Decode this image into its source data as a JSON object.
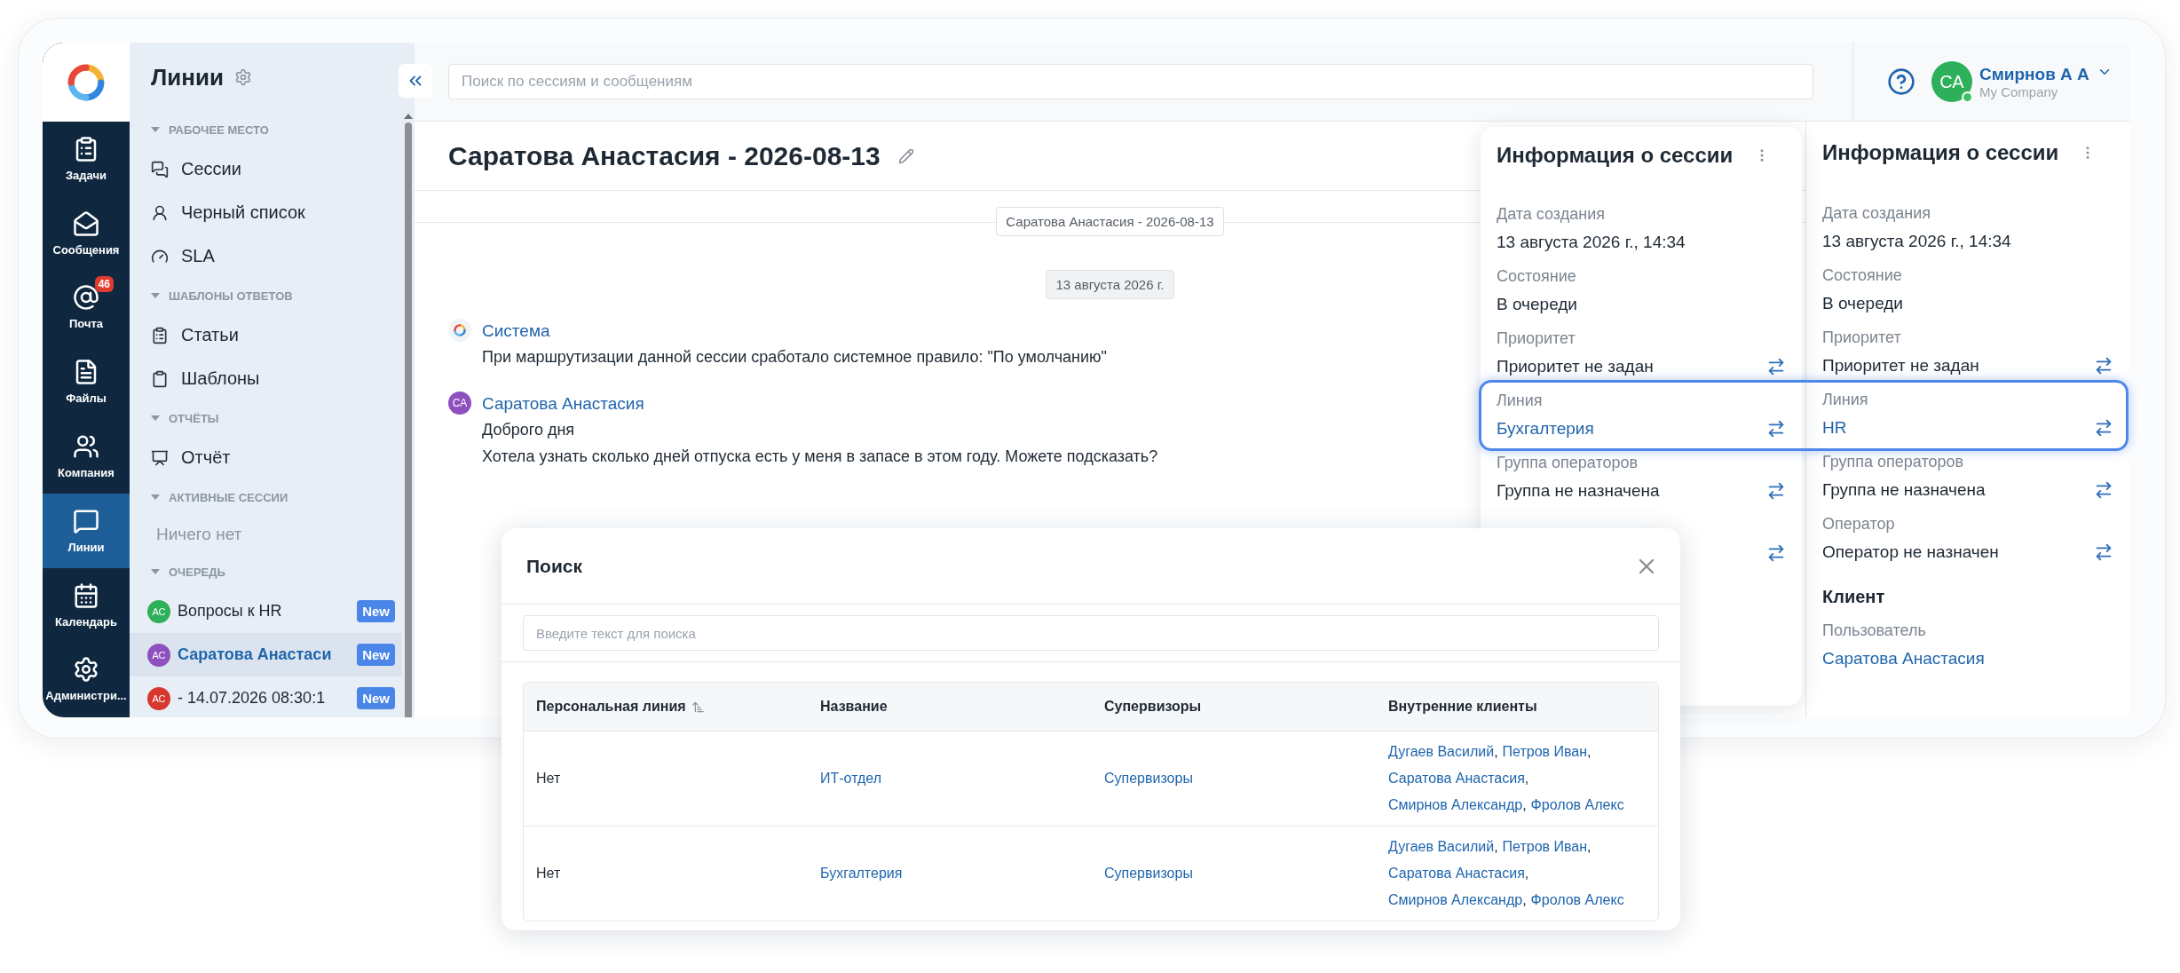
{
  "nav": {
    "items": [
      {
        "label": "Задачи",
        "selected": false
      },
      {
        "label": "Сообщения",
        "selected": false
      },
      {
        "label": "Почта",
        "badge": "46",
        "selected": false
      },
      {
        "label": "Файлы",
        "selected": false
      },
      {
        "label": "Компания",
        "selected": false
      },
      {
        "label": "Линии",
        "selected": true
      },
      {
        "label": "Календарь",
        "selected": false
      },
      {
        "label": "Администри...",
        "selected": false
      }
    ]
  },
  "sidebar": {
    "title": "Линии",
    "sections": [
      {
        "kind": "links",
        "title": "РАБОЧЕЕ МЕСТО",
        "items": [
          "Сессии",
          "Черный список",
          "SLA"
        ]
      },
      {
        "kind": "links",
        "title": "ШАБЛОНЫ ОТВЕТОВ",
        "items": [
          "Статьи",
          "Шаблоны"
        ]
      },
      {
        "kind": "links",
        "title": "ОТЧЁТЫ",
        "items": [
          "Отчёт"
        ]
      },
      {
        "kind": "empty",
        "title": "АКТИВНЫЕ СЕССИИ",
        "text": "Ничего нет"
      },
      {
        "kind": "queue",
        "title": "ОЧЕРЕДЬ",
        "items": [
          {
            "initials": "АС",
            "name": "Вопросы к HR",
            "badge": "New",
            "color": "#2eb05a",
            "selected": false
          },
          {
            "initials": "АС",
            "name": "Саратова Анастаси",
            "badge": "New",
            "color": "#8e4fbf",
            "selected": true
          },
          {
            "initials": "АС",
            "name": "- 14.07.2026 08:30:1",
            "badge": "New",
            "color": "#d7382e",
            "selected": false
          }
        ]
      }
    ]
  },
  "header": {
    "search_placeholder": "Поиск по сессиям и сообщениям",
    "user": {
      "initials": "СА",
      "name": "Смирнов А А",
      "company": "My Company",
      "online": true
    }
  },
  "chat": {
    "title": "Саратова Анастасия - 2026-08-13",
    "separator": "Саратова Анастасия - 2026-08-13",
    "date": "13 августа 2026 г.",
    "messages": [
      {
        "kind": "system",
        "author": "Система",
        "lines": [
          "При маршрутизации данной сессии сработало системное правило: \"По умолчанию\""
        ]
      },
      {
        "kind": "user",
        "initials": "СА",
        "author": "Саратова Анастасия",
        "lines": [
          "Доброго дня",
          "Хотела узнать сколько дней отпуска есть у меня в запасе в этом году. Можете подсказать?"
        ]
      }
    ]
  },
  "session_card": {
    "title": "Информация о сессии",
    "rows": [
      {
        "kind": "field",
        "label": "Дата создания",
        "value": "13 августа 2026 г., 14:34",
        "link": false,
        "swap": false
      },
      {
        "kind": "field",
        "label": "Состояние",
        "value": "В очереди",
        "link": false,
        "swap": false
      },
      {
        "kind": "field",
        "label": "Приоритет",
        "value": "Приоритет не задан",
        "link": false,
        "swap": true
      },
      {
        "kind": "field",
        "label": "Линия",
        "value": "Бухгалтерия",
        "link": true,
        "swap": true
      },
      {
        "kind": "field",
        "label": "Группа операторов",
        "value": "Группа не назначена",
        "link": false,
        "swap": true
      },
      {
        "kind": "field",
        "swap": true
      }
    ]
  },
  "session_panel": {
    "title": "Информация о сессии",
    "rows": [
      {
        "kind": "field",
        "label": "Дата создания",
        "value": "13 августа 2026 г., 14:34",
        "link": false,
        "swap": false
      },
      {
        "kind": "field",
        "label": "Состояние",
        "value": "В очереди",
        "link": false,
        "swap": false
      },
      {
        "kind": "field",
        "label": "Приоритет",
        "value": "Приоритет не задан",
        "link": false,
        "swap": true
      },
      {
        "kind": "field",
        "label": "Линия",
        "value": "HR",
        "link": true,
        "swap": true
      },
      {
        "kind": "field",
        "label": "Группа операторов",
        "value": "Группа не назначена",
        "link": false,
        "swap": true
      },
      {
        "kind": "field",
        "label": "Оператор",
        "value": "Оператор не назначен",
        "link": false,
        "swap": true
      },
      {
        "kind": "heading",
        "text": "Клиент"
      },
      {
        "kind": "field",
        "label": "Пользователь",
        "value": "Саратова Анастасия",
        "link": true,
        "swap": false
      }
    ]
  },
  "search_dialog": {
    "title": "Поиск",
    "placeholder": "Введите текст для поиска",
    "columns": [
      {
        "label": "Персональная линия",
        "sorted": true
      },
      {
        "label": "Название",
        "sorted": false
      },
      {
        "label": "Супервизоры",
        "sorted": false
      },
      {
        "label": "Внутренние клиенты",
        "sorted": false
      }
    ],
    "rows": [
      {
        "personal": "Нет",
        "name": "ИТ-отдел",
        "supervisors": "Супервизоры",
        "clients": [
          {
            "name": "Дугаев Василий",
            "sep": ","
          },
          {
            "name": "Петров Иван",
            "sep": ","
          },
          {
            "name": "Саратова Анастасия",
            "sep": ","
          },
          {
            "name": "Смирнов Александр",
            "sep": ","
          },
          {
            "name": "Фролов Алекс"
          }
        ]
      },
      {
        "personal": "Нет",
        "name": "Бухгалтерия",
        "supervisors": "Супервизоры",
        "clients": [
          {
            "name": "Дугаев Василий",
            "sep": ","
          },
          {
            "name": "Петров Иван",
            "sep": ","
          },
          {
            "name": "Саратова Анастасия",
            "sep": ","
          },
          {
            "name": "Смирнов Александр",
            "sep": ","
          },
          {
            "name": "Фролов Алекс"
          }
        ]
      }
    ]
  }
}
